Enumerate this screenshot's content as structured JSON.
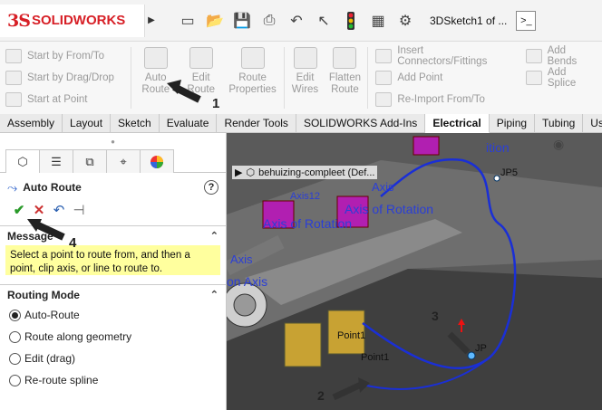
{
  "app": {
    "logo": "SOLIDWORKS",
    "doc_title": "3DSketch1 of ..."
  },
  "command_manager": {
    "left_column": [
      "Start by From/To",
      "Start by Drag/Drop",
      "Start at Point"
    ],
    "buttons": [
      {
        "label": "Auto Route",
        "lines": [
          "Auto",
          "Route"
        ]
      },
      {
        "label": "Edit Route",
        "lines": [
          "Edit",
          "Route"
        ]
      },
      {
        "label": "Route Properties",
        "lines": [
          "Route",
          "Properties"
        ]
      },
      {
        "label": "Edit Wires",
        "lines": [
          "Edit",
          "Wires"
        ]
      },
      {
        "label": "Flatten Route",
        "lines": [
          "Flatten",
          "Route"
        ]
      }
    ],
    "middle_column": [
      "Insert Connectors/Fittings",
      "Add Point",
      "Re-Import From/To"
    ],
    "right_column": [
      "Add Bends",
      "Add Splice"
    ]
  },
  "tabs": [
    "Assembly",
    "Layout",
    "Sketch",
    "Evaluate",
    "Render Tools",
    "SOLIDWORKS Add-Ins",
    "Electrical",
    "Piping",
    "Tubing",
    "Use"
  ],
  "active_tab": "Electrical",
  "property_manager": {
    "title": "Auto Route",
    "message_section": "Message",
    "message_text": "Select a point to route from, and then a point, clip axis, or line to route to.",
    "routing_mode_section": "Routing Mode",
    "routing_modes": [
      "Auto-Route",
      "Route along geometry",
      "Edit (drag)",
      "Re-route spline"
    ],
    "selected_mode": "Auto-Route"
  },
  "viewport": {
    "tree_node": "behuizing-compleet (Def...",
    "labels": {
      "axis": "Axis",
      "axis_of_rotation": "Axis of Rotation",
      "on_axis": "on Axis",
      "axis12": "Axis12",
      "point1": "Point1",
      "jp5": "JP5",
      "jp": "JP",
      "ition": "ition"
    },
    "callouts": [
      "1",
      "2",
      "3",
      "4"
    ],
    "route_color": "#1a2fd6"
  }
}
